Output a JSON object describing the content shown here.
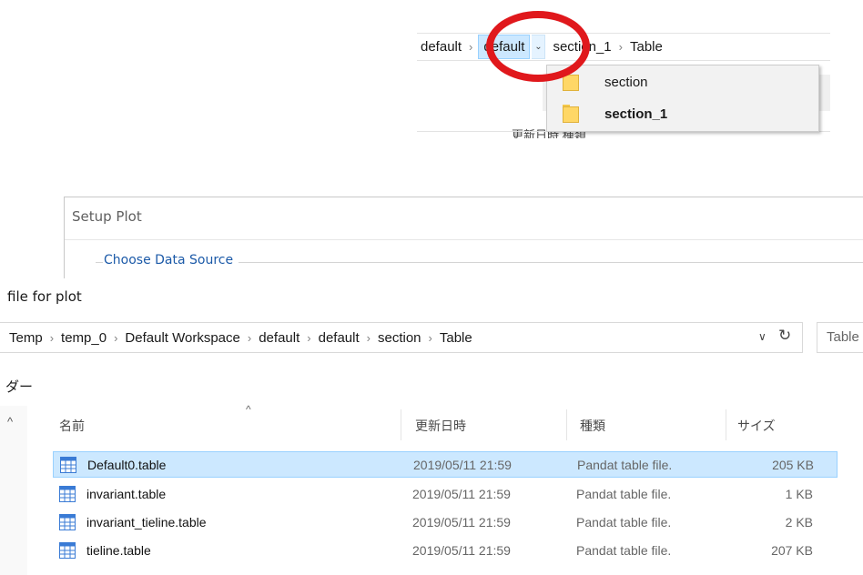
{
  "top_breadcrumb": {
    "segments": [
      "default",
      "default",
      "section_1",
      "Table"
    ],
    "active_index": 1,
    "partial_header_text": "更新日時 種類"
  },
  "dropdown": {
    "items": [
      {
        "label": "section",
        "bold": false
      },
      {
        "label": "section_1",
        "bold": true
      }
    ]
  },
  "highlight": {
    "color": "#e0181c"
  },
  "setup_plot": {
    "title": "Setup Plot",
    "group_label": "Choose Data Source"
  },
  "file_dialog": {
    "title": "file for plot",
    "address_segments": [
      "Temp",
      "temp_0",
      "Default Workspace",
      "default",
      "default",
      "section",
      "Table"
    ],
    "search_placeholder": "Table",
    "left_label": "ダー",
    "columns": {
      "name": "名前",
      "modified": "更新日時",
      "type": "種類",
      "size": "サイズ"
    },
    "files": [
      {
        "name": "Default0.table",
        "modified": "2019/05/11 21:59",
        "type": "Pandat table file.",
        "size": "205 KB",
        "selected": true
      },
      {
        "name": "invariant.table",
        "modified": "2019/05/11 21:59",
        "type": "Pandat table file.",
        "size": "1 KB",
        "selected": false
      },
      {
        "name": "invariant_tieline.table",
        "modified": "2019/05/11 21:59",
        "type": "Pandat table file.",
        "size": "2 KB",
        "selected": false
      },
      {
        "name": "tieline.table",
        "modified": "2019/05/11 21:59",
        "type": "Pandat table file.",
        "size": "207 KB",
        "selected": false
      }
    ]
  },
  "colors": {
    "selection": "#cce8ff",
    "selection_border": "#99d1ff",
    "link": "#1c5aa8"
  }
}
